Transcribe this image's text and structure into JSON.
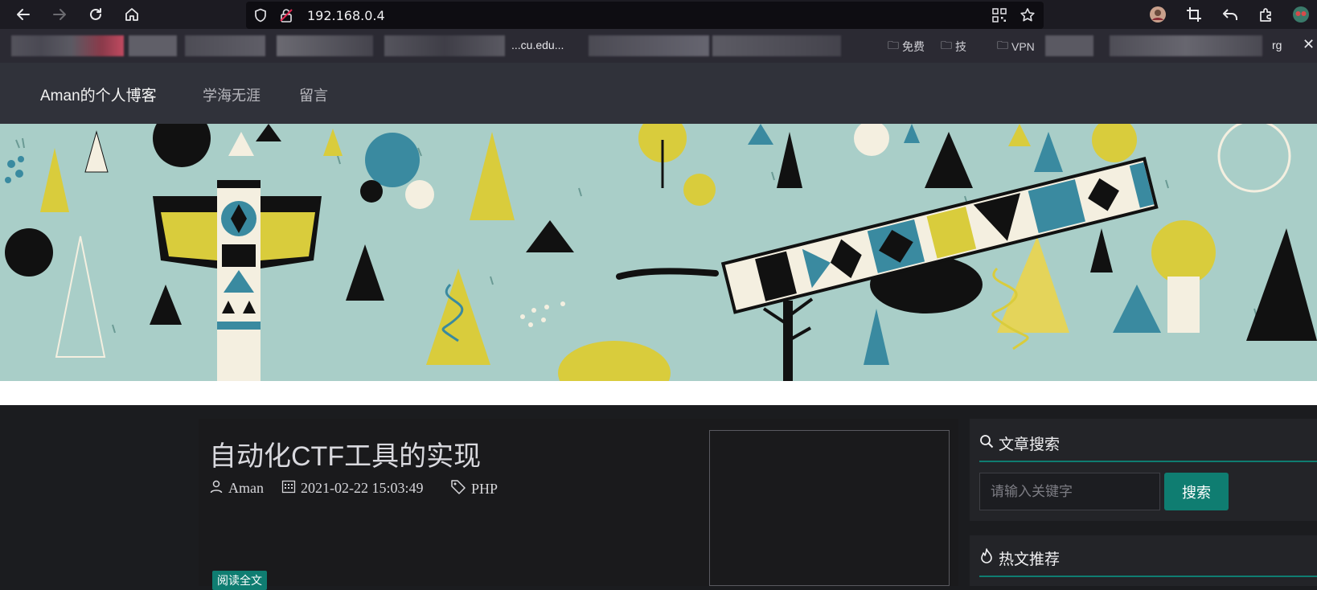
{
  "browser": {
    "url": "192.168.0.4",
    "bookmarks": {
      "folders": [
        "免费",
        "技",
        "VPN"
      ],
      "visible_text": [
        "...cu.edu...",
        "rg"
      ]
    }
  },
  "site": {
    "brand": "Aman的个人博客",
    "nav": [
      "学海无涯",
      "留言"
    ]
  },
  "article": {
    "title": "自动化CTF工具的实现",
    "author": "Aman",
    "date": "2021-02-22 15:03:49",
    "tag": "PHP",
    "read_more": "阅读全文"
  },
  "sidebar": {
    "search": {
      "title": "文章搜索",
      "placeholder": "请输入关键字",
      "button": "搜索"
    },
    "hot": {
      "title": "热文推荐"
    }
  },
  "colors": {
    "accent": "#0f7d71",
    "nav_bg": "#30323a",
    "page_bg": "#1b1c1f",
    "banner_bg": "#a9cec8"
  },
  "icons": [
    "back-arrow-icon",
    "forward-arrow-icon",
    "reload-icon",
    "home-icon",
    "shield-icon",
    "insecure-lock-icon",
    "qr-code-icon",
    "star-icon",
    "avatar-icon",
    "crop-icon",
    "undo-icon",
    "extensions-icon",
    "user-icon",
    "calendar-icon",
    "tag-icon",
    "search-icon",
    "fire-icon",
    "folder-icon",
    "close-icon"
  ]
}
